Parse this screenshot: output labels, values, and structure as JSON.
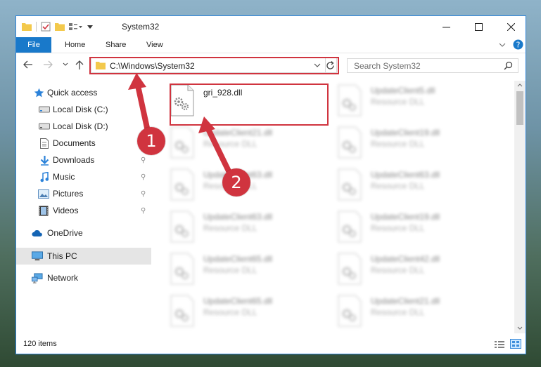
{
  "window": {
    "title": "System32"
  },
  "ribbon": {
    "tabs": [
      {
        "label": "File"
      },
      {
        "label": "Home"
      },
      {
        "label": "Share"
      },
      {
        "label": "View"
      }
    ]
  },
  "address": {
    "path": "C:\\Windows\\System32"
  },
  "search": {
    "placeholder": "Search System32"
  },
  "nav": {
    "items": [
      {
        "label": "Quick access",
        "icon": "star-icon"
      },
      {
        "label": "Local Disk (C:)",
        "icon": "drive-icon"
      },
      {
        "label": "Local Disk (D:)",
        "icon": "drive-icon"
      },
      {
        "label": "Documents",
        "icon": "document-icon",
        "pinned": true
      },
      {
        "label": "Downloads",
        "icon": "download-arrow-icon",
        "pinned": true
      },
      {
        "label": "Music",
        "icon": "music-note-icon",
        "pinned": true
      },
      {
        "label": "Pictures",
        "icon": "picture-icon",
        "pinned": true
      },
      {
        "label": "Videos",
        "icon": "film-icon",
        "pinned": true
      },
      {
        "label": "OneDrive",
        "icon": "cloud-icon"
      },
      {
        "label": "This PC",
        "icon": "monitor-icon"
      },
      {
        "label": "Network",
        "icon": "network-icon"
      }
    ]
  },
  "files": {
    "highlighted": {
      "name": "gri_928.dll"
    },
    "left_column": [
      {
        "name": "UpdateClient21.dll",
        "type": "Resource DLL"
      },
      {
        "name": "UpdateClient63.dll",
        "type": "Resource DLL"
      },
      {
        "name": "UpdateClient63.dll",
        "type": "Resource DLL"
      },
      {
        "name": "UpdateClient65.dll",
        "type": "Resource DLL"
      },
      {
        "name": "UpdateClient65.dll",
        "type": "Resource DLL"
      }
    ],
    "right_column": [
      {
        "name": "UpdateClient5.dll",
        "type": "Resource DLL"
      },
      {
        "name": "UpdateClient19.dll",
        "type": "Resource DLL"
      },
      {
        "name": "UpdateClient63.dll",
        "type": "Resource DLL"
      },
      {
        "name": "UpdateClient19.dll",
        "type": "Resource DLL"
      },
      {
        "name": "UpdateClient42.dll",
        "type": "Resource DLL"
      },
      {
        "name": "UpdateClient21.dll",
        "type": "Resource DLL"
      }
    ]
  },
  "status": {
    "item_count": "120 items"
  },
  "annotations": {
    "marker1": "1",
    "marker2": "2"
  },
  "colors": {
    "accent": "#1979ca",
    "highlight_red": "#d0343f",
    "folder_yellow": "#f3c94c"
  }
}
